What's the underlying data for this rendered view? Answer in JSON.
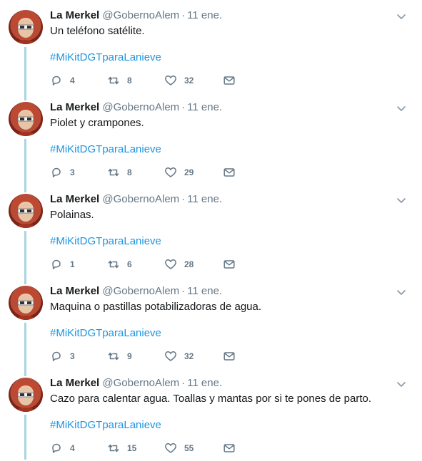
{
  "tweets": [
    {
      "name": "La Merkel",
      "handle": "@GobernoAlem",
      "date": "11 ene.",
      "text": "Un teléfono satélite.",
      "hashtag": "#MiKitDGTparaLanieve",
      "replies": "4",
      "retweets": "8",
      "likes": "32"
    },
    {
      "name": "La Merkel",
      "handle": "@GobernoAlem",
      "date": "11 ene.",
      "text": "Piolet y crampones.",
      "hashtag": "#MiKitDGTparaLanieve",
      "replies": "3",
      "retweets": "8",
      "likes": "29"
    },
    {
      "name": "La Merkel",
      "handle": "@GobernoAlem",
      "date": "11 ene.",
      "text": "Polainas.",
      "hashtag": "#MiKitDGTparaLanieve",
      "replies": "1",
      "retweets": "6",
      "likes": "28"
    },
    {
      "name": "La Merkel",
      "handle": "@GobernoAlem",
      "date": "11 ene.",
      "text": "Maquina o pastillas potabilizadoras de agua.",
      "hashtag": "#MiKitDGTparaLanieve",
      "replies": "3",
      "retweets": "9",
      "likes": "32"
    },
    {
      "name": "La Merkel",
      "handle": "@GobernoAlem",
      "date": "11 ene.",
      "text": "Cazo para calentar agua. Toallas y mantas por si te pones de parto.",
      "hashtag": "#MiKitDGTparaLanieve",
      "replies": "4",
      "retweets": "15",
      "likes": "55"
    }
  ],
  "icons": {
    "reply": "reply-icon",
    "retweet": "retweet-icon",
    "like": "heart-icon",
    "dm": "envelope-icon",
    "caret": "chevron-down-icon"
  },
  "colors": {
    "link": "#1b95e0",
    "muted": "#657786",
    "thread": "#a8d5e0"
  }
}
